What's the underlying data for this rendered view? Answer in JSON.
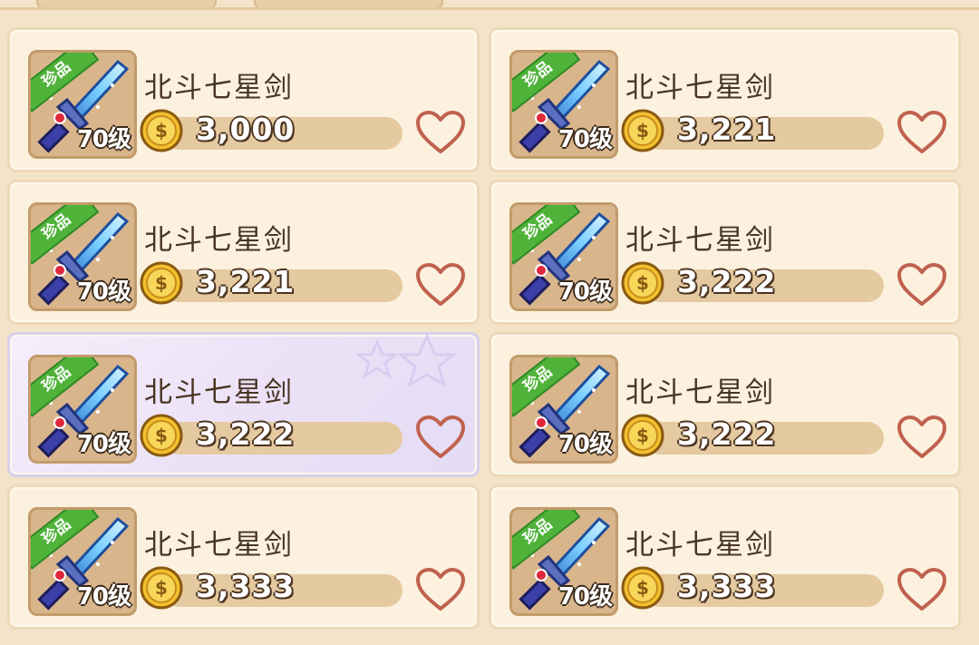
{
  "items": [
    {
      "name": "北斗七星剑",
      "badge": "珍品",
      "level": "70级",
      "price": "3,000",
      "selected": false
    },
    {
      "name": "北斗七星剑",
      "badge": "珍品",
      "level": "70级",
      "price": "3,221",
      "selected": false
    },
    {
      "name": "北斗七星剑",
      "badge": "珍品",
      "level": "70级",
      "price": "3,221",
      "selected": false
    },
    {
      "name": "北斗七星剑",
      "badge": "珍品",
      "level": "70级",
      "price": "3,222",
      "selected": false
    },
    {
      "name": "北斗七星剑",
      "badge": "珍品",
      "level": "70级",
      "price": "3,222",
      "selected": true
    },
    {
      "name": "北斗七星剑",
      "badge": "珍品",
      "level": "70级",
      "price": "3,222",
      "selected": false
    },
    {
      "name": "北斗七星剑",
      "badge": "珍品",
      "level": "70级",
      "price": "3,333",
      "selected": false
    },
    {
      "name": "北斗七星剑",
      "badge": "珍品",
      "level": "70级",
      "price": "3,333",
      "selected": false
    }
  ],
  "icons": {
    "item": "sword-icon",
    "currency": "gold-coin-icon",
    "favorite": "heart-outline-icon"
  },
  "colors": {
    "background": "#f3e3c8",
    "card": "#fbf1de",
    "selected_card": "#ece2f7",
    "badge_green": "#4fb33a",
    "coin_gold": "#f2c12e",
    "heart": "#c0614f"
  }
}
